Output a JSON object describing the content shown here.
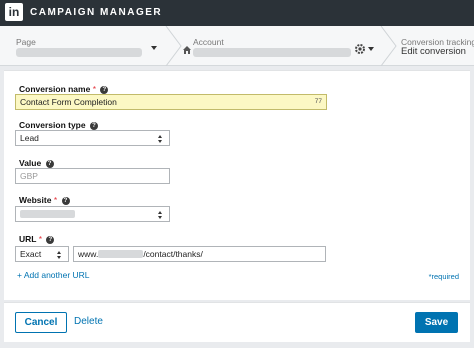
{
  "app": {
    "logo_text": "in",
    "title": "CAMPAIGN MANAGER"
  },
  "breadcrumb": {
    "page_label": "Page",
    "account_label": "Account",
    "conversion_label": "Conversion tracking",
    "conversion_value": "Edit conversion"
  },
  "form": {
    "conversion_name": {
      "label": "Conversion name",
      "required_mark": "*",
      "value": "Contact Form Completion",
      "char_count": "77"
    },
    "conversion_type": {
      "label": "Conversion type",
      "selected": "Lead"
    },
    "value": {
      "label": "Value",
      "placeholder": "GBP"
    },
    "website": {
      "label": "Website",
      "required_mark": "*"
    },
    "url": {
      "label": "URL",
      "required_mark": "*",
      "match_type": "Exact",
      "url_prefix": "www.",
      "url_suffix": "/contact/thanks/"
    },
    "add_url": "+ Add another URL",
    "required_note": "*required"
  },
  "footer": {
    "cancel": "Cancel",
    "delete": "Delete",
    "save": "Save"
  },
  "colors": {
    "topbar": "#2b3238",
    "accent": "#0073b1",
    "highlight": "#fcf8c4"
  }
}
